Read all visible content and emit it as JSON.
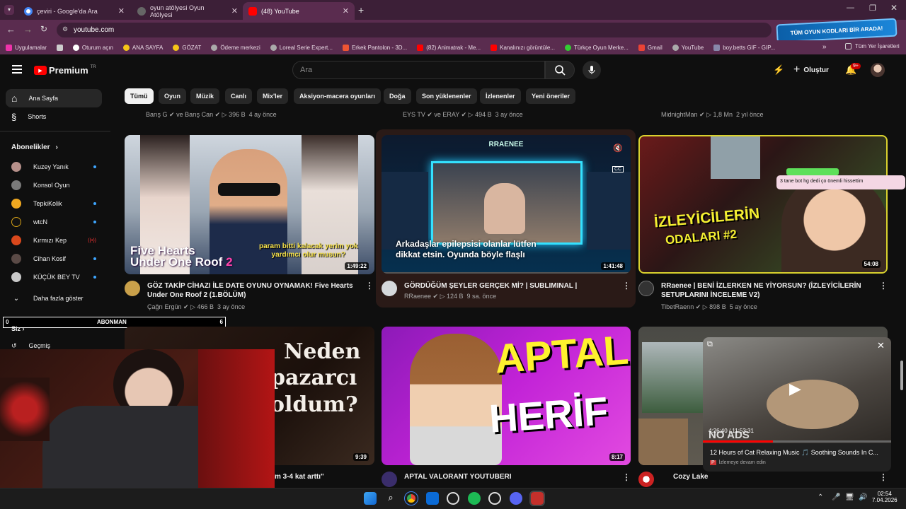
{
  "browser": {
    "tabs": [
      {
        "title": "çeviri - Google'da Ara",
        "color": "#4285f4"
      },
      {
        "title": "oyun atölyesi Oyun Atölyesi",
        "color": "#888888"
      },
      {
        "title": "(48) YouTube",
        "color": "#ff0000"
      }
    ],
    "url": "youtube.com",
    "banner": "TÜM OYUN KODLARI BİR ARADA!",
    "bookmarks": [
      "Uygulamalar",
      "Oturum açın",
      "ANA SAYFA",
      "GÖZAT",
      "Ödeme merkezi",
      "Loreal Serie Expert...",
      "Erkek Pantolon - 3D...",
      "(82) Animatrak - Me...",
      "Kanalınızı görüntüle...",
      "Türkçe Oyun Merke...",
      "Gmail",
      "YouTube",
      "boy.betts GIF - GIP..."
    ],
    "all_bookmarks": "Tüm Yer İşaretleri"
  },
  "yt": {
    "logo": "Premium",
    "logo_sup": "TR",
    "search_placeholder": "Ara",
    "create_label": "Oluştur",
    "notif_count": "9+",
    "chips": [
      "Tümü",
      "Oyun",
      "Müzik",
      "Canlı",
      "Mix'ler",
      "Aksiyon-macera oyunları",
      "Doğa",
      "Son yüklenenler",
      "İzlenenler",
      "Yeni öneriler"
    ]
  },
  "sidebar": {
    "home": "Ana Sayfa",
    "shorts": "Shorts",
    "subs_header": "Abonelikler",
    "subs": [
      "Kuzey Yanık",
      "Konsol Oyun",
      "TepkiKolik",
      "wtcN",
      "Kırmızı Kep",
      "Cihan Kosif",
      "KÜÇÜK BEY TV"
    ],
    "more": "Daha fazla göster",
    "you": "Siz",
    "history": "Geçmiş"
  },
  "overlay": {
    "left": "0",
    "center": "ABONMAN",
    "right": "6"
  },
  "top_row_meta": [
    {
      "channel": "Barış G",
      "meta": "ve Barış Can",
      "views": "396 B",
      "ago": "4 ay önce"
    },
    {
      "channel": "EYS TV",
      "meta": "ve ERAY",
      "views": "494 B",
      "ago": "3 ay önce"
    },
    {
      "channel": "MidnightMan",
      "meta": "",
      "views": "1,8 Mn",
      "ago": "2 yıl önce"
    }
  ],
  "videos": [
    {
      "title1": "GÖZ TAKİP CİHAZI İLE DATE OYUNU OYNAMAK! Five Hearts",
      "title2": "Under One Roof 2 (1.BÖLÜM)",
      "channel": "Çağrı Ergün",
      "views": "466 B",
      "ago": "3 ay önce",
      "duration": "1:49:22",
      "thumb_text1": "Five Hearts",
      "thumb_text2": "Under One Roof",
      "thumb_num": "2",
      "thumb_caption1": "param bitti kalacak yerim yok",
      "thumb_caption2": "yardımcı olur musun?"
    },
    {
      "title1": "GÖRDÜĞÜM ŞEYLER GERÇEK Mİ? | SUBLIMINAL |",
      "title2": "",
      "channel": "RRaenee",
      "views": "124 B",
      "ago": "9 sa. önce",
      "duration": "1:41:48",
      "thumb_header": "RRAENEE",
      "caption1": "Arkadaşlar epilepsisi olanlar lütfen",
      "caption2": "dikkat etsin. Oyunda böyle flaşlı",
      "cc": "CC"
    },
    {
      "title1": "RRaenee | BENİ İZLERKEN NE YİYORSUN? (İZLEYİCİLERİN",
      "title2": "SETUPLARINI İNCELEME V2)",
      "channel": "TibetRaenn",
      "views": "898 B",
      "ago": "5 ay önce",
      "duration": "54:08",
      "thumb_text1": "İZLEYİCİLERİN",
      "thumb_text2": "ODALARI #2",
      "chat": "3 tane bot hg dedi ço önemli hissettim"
    }
  ],
  "row2": [
    {
      "duration": "9:39",
      "thumb_text1": "Neden",
      "thumb_text2": "pazarcı",
      "thumb_text3": "oldum?",
      "title": "m 3-4 kat arttı\""
    },
    {
      "duration": "8:17",
      "thumb_text1": "APTAL",
      "thumb_text2": "HERİF",
      "title": "APTAL VALORANT YOUTUBERI"
    },
    {
      "title": "Cozy Lake"
    }
  ],
  "miniplayer": {
    "time": "4:26:40 / 11:53:31",
    "title": "12 Hours of Cat Relaxing Music 🎵 Soothing Sounds In C...",
    "sub": "İzlemeye devam edin",
    "noads": "NO ADS"
  },
  "taskbar": {
    "time": "02:54",
    "date": "7.04.2026"
  }
}
